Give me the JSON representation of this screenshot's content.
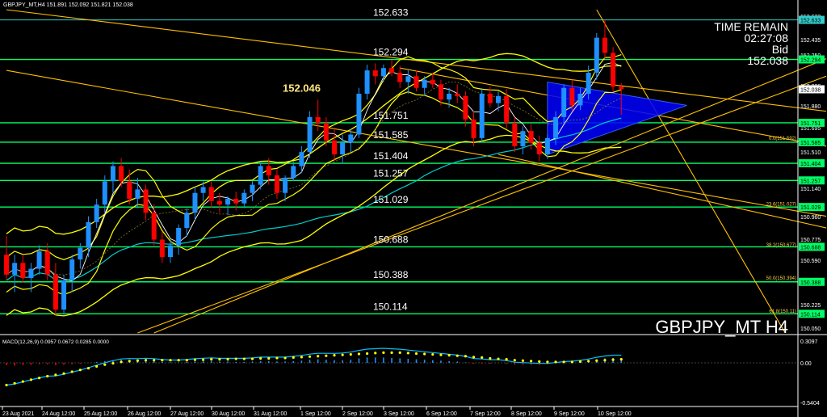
{
  "header": {
    "symbol_line": "GBPJPY_MT,H4 151.891 152.092 151.821 152.038"
  },
  "watermark": "GBPJPY_MT H4",
  "info_panel": {
    "line1": "TIME REMAIN",
    "line2": "02:27:08",
    "line3": "Bid",
    "line4": "152.038"
  },
  "macd": {
    "label": "MACD(12,26,9) 0.0957 0.0672 0.0285 0.0000",
    "axis": [
      "0.3097",
      "0.00",
      "-0.5404"
    ]
  },
  "colors": {
    "background": "#000000",
    "bull": "#1e90ff",
    "bear": "#ff0000",
    "bands": "#ffff00",
    "trendline": "#ffc000",
    "level_line": "#00ff66",
    "ma_cyan": "#00cccc",
    "triangle": "#0000ff"
  },
  "chart_data": {
    "type": "candlestick",
    "ylim": [
      149.95,
      152.72
    ],
    "price_axis_ticks": [
      "152.633",
      "152.435",
      "152.250",
      "152.086",
      "151.880",
      "151.695",
      "151.510",
      "151.325",
      "151.140",
      "150.960",
      "150.775",
      "150.590",
      "150.410",
      "150.225",
      "150.050"
    ],
    "price_axis_boxes": [
      "152.633",
      "152.294",
      "152.038",
      "151.751",
      "151.585",
      "151.404",
      "151.257",
      "151.029",
      "150.688",
      "150.388",
      "150.114"
    ],
    "x_labels": [
      "23 Aug 2021",
      "24 Aug 12:00",
      "25 Aug 12:00",
      "26 Aug 12:00",
      "27 Aug 12:00",
      "30 Aug 12:00",
      "31 Aug 12:00",
      "1 Sep 12:00",
      "2 Sep 12:00",
      "3 Sep 12:00",
      "6 Sep 12:00",
      "7 Sep 12:00",
      "8 Sep 12:00",
      "9 Sep 12:00",
      "10 Sep 12:00"
    ],
    "levels": [
      {
        "price": 152.633,
        "label": "152.633"
      },
      {
        "price": 152.294,
        "label": "152.294"
      },
      {
        "price": 151.751,
        "label": "151.751"
      },
      {
        "price": 151.585,
        "label": "151.585"
      },
      {
        "price": 151.404,
        "label": "151.404"
      },
      {
        "price": 151.257,
        "label": "151.257"
      },
      {
        "price": 151.029,
        "label": "151.029"
      },
      {
        "price": 150.688,
        "label": "150.688"
      },
      {
        "price": 150.388,
        "label": "150.388"
      },
      {
        "price": 150.114,
        "label": "150.114"
      }
    ],
    "fib_labels": [
      {
        "price": 151.592,
        "label": "0.0(151.592)"
      },
      {
        "price": 151.027,
        "label": "23.6(151.027)"
      },
      {
        "price": 150.677,
        "label": "38.2(150.677)"
      },
      {
        "price": 150.394,
        "label": "50.0(150.394)"
      },
      {
        "price": 150.11,
        "label": "61.8(150.11)"
      }
    ],
    "highlight_price": {
      "price": 152.046,
      "label": "152.046"
    },
    "candles": [
      {
        "o": 150.62,
        "h": 150.78,
        "l": 150.4,
        "c": 150.45
      },
      {
        "o": 150.45,
        "h": 150.62,
        "l": 150.3,
        "c": 150.55
      },
      {
        "o": 150.55,
        "h": 150.62,
        "l": 150.38,
        "c": 150.42
      },
      {
        "o": 150.42,
        "h": 150.55,
        "l": 150.3,
        "c": 150.5
      },
      {
        "o": 150.5,
        "h": 150.7,
        "l": 150.45,
        "c": 150.65
      },
      {
        "o": 150.65,
        "h": 150.72,
        "l": 150.4,
        "c": 150.45
      },
      {
        "o": 150.45,
        "h": 150.55,
        "l": 150.1,
        "c": 150.15
      },
      {
        "o": 150.15,
        "h": 150.45,
        "l": 150.1,
        "c": 150.4
      },
      {
        "o": 150.4,
        "h": 150.62,
        "l": 150.3,
        "c": 150.58
      },
      {
        "o": 150.58,
        "h": 150.72,
        "l": 150.5,
        "c": 150.68
      },
      {
        "o": 150.68,
        "h": 150.95,
        "l": 150.6,
        "c": 150.9
      },
      {
        "o": 150.9,
        "h": 151.1,
        "l": 150.85,
        "c": 151.05
      },
      {
        "o": 151.05,
        "h": 151.3,
        "l": 150.98,
        "c": 151.25
      },
      {
        "o": 151.25,
        "h": 151.42,
        "l": 151.15,
        "c": 151.38
      },
      {
        "o": 151.38,
        "h": 151.45,
        "l": 151.2,
        "c": 151.25
      },
      {
        "o": 151.25,
        "h": 151.35,
        "l": 151.05,
        "c": 151.1
      },
      {
        "o": 151.1,
        "h": 151.28,
        "l": 151.02,
        "c": 151.18
      },
      {
        "o": 151.18,
        "h": 151.22,
        "l": 150.92,
        "c": 150.98
      },
      {
        "o": 150.98,
        "h": 151.05,
        "l": 150.7,
        "c": 150.75
      },
      {
        "o": 150.75,
        "h": 150.82,
        "l": 150.55,
        "c": 150.6
      },
      {
        "o": 150.6,
        "h": 150.75,
        "l": 150.55,
        "c": 150.7
      },
      {
        "o": 150.7,
        "h": 150.88,
        "l": 150.62,
        "c": 150.85
      },
      {
        "o": 150.85,
        "h": 151.02,
        "l": 150.78,
        "c": 150.98
      },
      {
        "o": 150.98,
        "h": 151.2,
        "l": 150.92,
        "c": 151.15
      },
      {
        "o": 151.15,
        "h": 151.25,
        "l": 151.08,
        "c": 151.2
      },
      {
        "o": 151.2,
        "h": 151.25,
        "l": 151.02,
        "c": 151.08
      },
      {
        "o": 151.08,
        "h": 151.15,
        "l": 150.98,
        "c": 151.05
      },
      {
        "o": 151.05,
        "h": 151.12,
        "l": 150.96,
        "c": 151.1
      },
      {
        "o": 151.1,
        "h": 151.16,
        "l": 151.0,
        "c": 151.06
      },
      {
        "o": 151.06,
        "h": 151.18,
        "l": 151.02,
        "c": 151.15
      },
      {
        "o": 151.15,
        "h": 151.25,
        "l": 151.08,
        "c": 151.22
      },
      {
        "o": 151.22,
        "h": 151.42,
        "l": 151.18,
        "c": 151.38
      },
      {
        "o": 151.38,
        "h": 151.45,
        "l": 151.22,
        "c": 151.3
      },
      {
        "o": 151.3,
        "h": 151.35,
        "l": 151.1,
        "c": 151.15
      },
      {
        "o": 151.15,
        "h": 151.3,
        "l": 151.08,
        "c": 151.28
      },
      {
        "o": 151.28,
        "h": 151.42,
        "l": 151.25,
        "c": 151.38
      },
      {
        "o": 151.38,
        "h": 151.55,
        "l": 151.32,
        "c": 151.5
      },
      {
        "o": 151.5,
        "h": 151.85,
        "l": 151.45,
        "c": 151.8
      },
      {
        "o": 151.8,
        "h": 151.95,
        "l": 151.68,
        "c": 151.75
      },
      {
        "o": 151.75,
        "h": 151.8,
        "l": 151.55,
        "c": 151.6
      },
      {
        "o": 151.6,
        "h": 151.7,
        "l": 151.42,
        "c": 151.48
      },
      {
        "o": 151.48,
        "h": 151.65,
        "l": 151.4,
        "c": 151.58
      },
      {
        "o": 151.58,
        "h": 151.7,
        "l": 151.5,
        "c": 151.65
      },
      {
        "o": 151.65,
        "h": 152.05,
        "l": 151.62,
        "c": 152.0
      },
      {
        "o": 152.0,
        "h": 152.25,
        "l": 151.95,
        "c": 152.2
      },
      {
        "o": 152.2,
        "h": 152.26,
        "l": 152.08,
        "c": 152.15
      },
      {
        "o": 152.15,
        "h": 152.25,
        "l": 152.1,
        "c": 152.22
      },
      {
        "o": 152.22,
        "h": 152.29,
        "l": 152.15,
        "c": 152.18
      },
      {
        "o": 152.18,
        "h": 152.24,
        "l": 152.05,
        "c": 152.1
      },
      {
        "o": 152.1,
        "h": 152.2,
        "l": 152.0,
        "c": 152.15
      },
      {
        "o": 152.15,
        "h": 152.2,
        "l": 152.02,
        "c": 152.05
      },
      {
        "o": 152.05,
        "h": 152.15,
        "l": 151.98,
        "c": 152.12
      },
      {
        "o": 152.12,
        "h": 152.18,
        "l": 152.05,
        "c": 152.08
      },
      {
        "o": 152.08,
        "h": 152.12,
        "l": 151.9,
        "c": 151.95
      },
      {
        "o": 151.95,
        "h": 152.05,
        "l": 151.88,
        "c": 152.0
      },
      {
        "o": 152.0,
        "h": 152.08,
        "l": 151.92,
        "c": 151.98
      },
      {
        "o": 151.98,
        "h": 152.02,
        "l": 151.72,
        "c": 151.78
      },
      {
        "o": 151.78,
        "h": 151.85,
        "l": 151.55,
        "c": 151.62
      },
      {
        "o": 151.62,
        "h": 152.05,
        "l": 151.58,
        "c": 152.0
      },
      {
        "o": 152.0,
        "h": 152.06,
        "l": 151.88,
        "c": 151.92
      },
      {
        "o": 151.92,
        "h": 152.02,
        "l": 151.85,
        "c": 151.98
      },
      {
        "o": 151.98,
        "h": 152.04,
        "l": 151.7,
        "c": 151.75
      },
      {
        "o": 151.75,
        "h": 151.8,
        "l": 151.5,
        "c": 151.55
      },
      {
        "o": 151.55,
        "h": 151.72,
        "l": 151.48,
        "c": 151.68
      },
      {
        "o": 151.68,
        "h": 151.74,
        "l": 151.52,
        "c": 151.58
      },
      {
        "o": 151.58,
        "h": 151.64,
        "l": 151.42,
        "c": 151.48
      },
      {
        "o": 151.48,
        "h": 151.65,
        "l": 151.44,
        "c": 151.62
      },
      {
        "o": 151.62,
        "h": 151.85,
        "l": 151.56,
        "c": 151.8
      },
      {
        "o": 151.8,
        "h": 152.08,
        "l": 151.75,
        "c": 152.05
      },
      {
        "o": 152.05,
        "h": 152.12,
        "l": 151.85,
        "c": 151.9
      },
      {
        "o": 151.9,
        "h": 152.05,
        "l": 151.86,
        "c": 152.0
      },
      {
        "o": 152.0,
        "h": 152.24,
        "l": 151.95,
        "c": 152.18
      },
      {
        "o": 152.18,
        "h": 152.52,
        "l": 152.12,
        "c": 152.48
      },
      {
        "o": 152.48,
        "h": 152.63,
        "l": 152.3,
        "c": 152.35
      },
      {
        "o": 152.35,
        "h": 152.4,
        "l": 152.02,
        "c": 152.06
      },
      {
        "o": 152.06,
        "h": 152.09,
        "l": 151.82,
        "c": 152.04
      }
    ],
    "macd_histogram": [
      -0.05,
      -0.06,
      -0.05,
      -0.04,
      -0.03,
      -0.03,
      -0.05,
      -0.04,
      -0.03,
      -0.02,
      0.0,
      0.02,
      0.04,
      0.06,
      0.07,
      0.06,
      0.05,
      0.05,
      0.04,
      0.02,
      0.01,
      0.01,
      0.02,
      0.03,
      0.04,
      0.04,
      0.03,
      0.03,
      0.02,
      0.02,
      0.03,
      0.04,
      0.04,
      0.03,
      0.03,
      0.04,
      0.05,
      0.07,
      0.08,
      0.07,
      0.06,
      0.06,
      0.07,
      0.1,
      0.12,
      0.12,
      0.12,
      0.11,
      0.1,
      0.09,
      0.08,
      0.07,
      0.06,
      0.05,
      0.04,
      0.03,
      0.01,
      -0.02,
      -0.02,
      -0.02,
      -0.01,
      -0.02,
      -0.04,
      -0.04,
      -0.04,
      -0.04,
      -0.03,
      -0.01,
      0.01,
      0.02,
      0.03,
      0.05,
      0.08,
      0.1,
      0.11,
      0.1
    ],
    "macd_signal": [
      -0.5,
      -0.46,
      -0.42,
      -0.38,
      -0.34,
      -0.3,
      -0.27,
      -0.24,
      -0.2,
      -0.16,
      -0.12,
      -0.08,
      -0.04,
      -0.01,
      0.02,
      0.04,
      0.05,
      0.06,
      0.06,
      0.06,
      0.06,
      0.06,
      0.06,
      0.07,
      0.07,
      0.08,
      0.08,
      0.08,
      0.09,
      0.09,
      0.09,
      0.1,
      0.1,
      0.11,
      0.11,
      0.12,
      0.13,
      0.14,
      0.15,
      0.16,
      0.17,
      0.18,
      0.19,
      0.2,
      0.21,
      0.22,
      0.23,
      0.23,
      0.23,
      0.22,
      0.21,
      0.2,
      0.19,
      0.18,
      0.17,
      0.16,
      0.15,
      0.13,
      0.12,
      0.1,
      0.09,
      0.08,
      0.06,
      0.05,
      0.04,
      0.03,
      0.02,
      0.02,
      0.02,
      0.02,
      0.03,
      0.04,
      0.05,
      0.06,
      0.07,
      0.08
    ]
  }
}
